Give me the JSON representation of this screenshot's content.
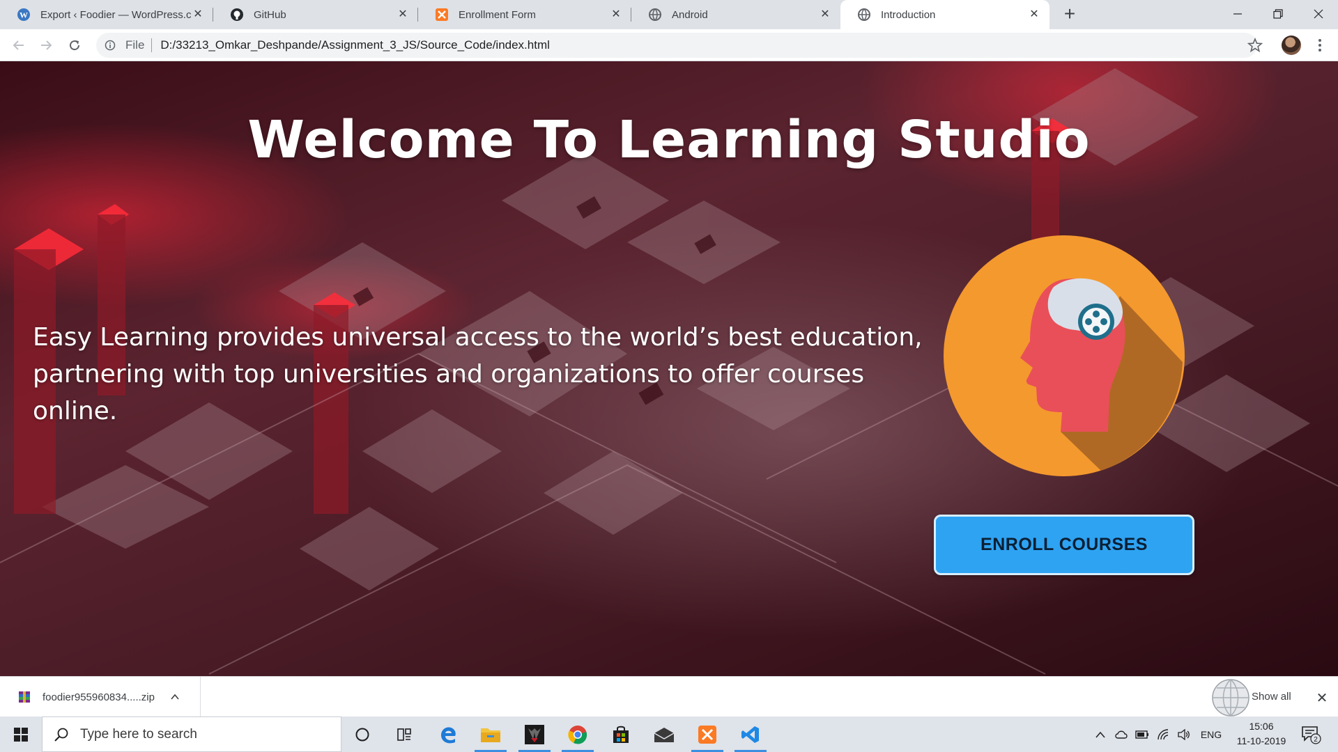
{
  "tabs": [
    {
      "title": "Export ‹ Foodier — WordPress.co",
      "favicon": "wordpress-icon",
      "active": false
    },
    {
      "title": "GitHub",
      "favicon": "github-icon",
      "active": false
    },
    {
      "title": "Enrollment Form",
      "favicon": "xampp-icon",
      "active": false
    },
    {
      "title": "Android",
      "favicon": "globe-icon",
      "active": false
    },
    {
      "title": "Introduction",
      "favicon": "globe-icon",
      "active": true
    }
  ],
  "toolbar": {
    "scheme": "File",
    "url": "D:/33213_Omkar_Deshpande/Assignment_3_JS/Source_Code/index.html"
  },
  "page": {
    "title": "Welcome To Learning Studio",
    "description": "Easy Learning provides universal access to the world’s best education, partnering with top universities and organizations to offer courses online.",
    "button_label": "ENROLL COURSES",
    "accent_color": "#2ea3f2",
    "logo_color": "#f4992e"
  },
  "downloads": {
    "file_name": "foodier955960834.....zip",
    "show_all": "Show all"
  },
  "taskbar": {
    "search_placeholder": "Type here to search",
    "language": "ENG",
    "time": "15:06",
    "date": "11-10-2019",
    "notification_count": "2"
  }
}
